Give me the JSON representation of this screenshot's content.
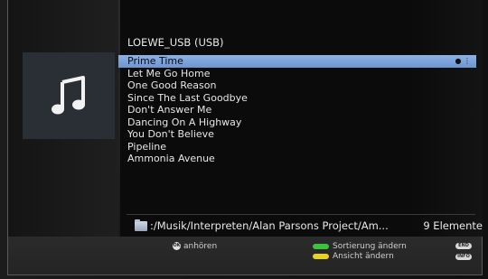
{
  "header": {
    "source_title": "LOEWE_USB (USB)"
  },
  "art": {
    "icon": "music-note-icon"
  },
  "list": {
    "items": [
      {
        "label": "Prime Time",
        "selected": true
      },
      {
        "label": "Let Me Go Home",
        "selected": false
      },
      {
        "label": "One Good Reason",
        "selected": false
      },
      {
        "label": "Since The Last Goodbye",
        "selected": false
      },
      {
        "label": "Don't Answer Me",
        "selected": false
      },
      {
        "label": "Dancing On A Highway",
        "selected": false
      },
      {
        "label": "You Don't Believe",
        "selected": false
      },
      {
        "label": "Pipeline",
        "selected": false
      },
      {
        "label": "Ammonia Avenue",
        "selected": false
      }
    ],
    "selected_badges": [
      "ok-icon",
      "nav-arrows-icon"
    ]
  },
  "path_bar": {
    "path": ":/Musik/Interpreten/Alan Parsons Project/Am...",
    "count": "9 Elemente"
  },
  "footer": {
    "ok_label": "anhören",
    "green_label": "Sortierung ändern",
    "yellow_label": "Ansicht ändern",
    "end_key": "END",
    "info_key": "INFO"
  },
  "colors": {
    "selection": "#7aa2da",
    "art_bg": "#2a2f35",
    "green_key": "#3cc23c",
    "yellow_key": "#e6d31e"
  }
}
